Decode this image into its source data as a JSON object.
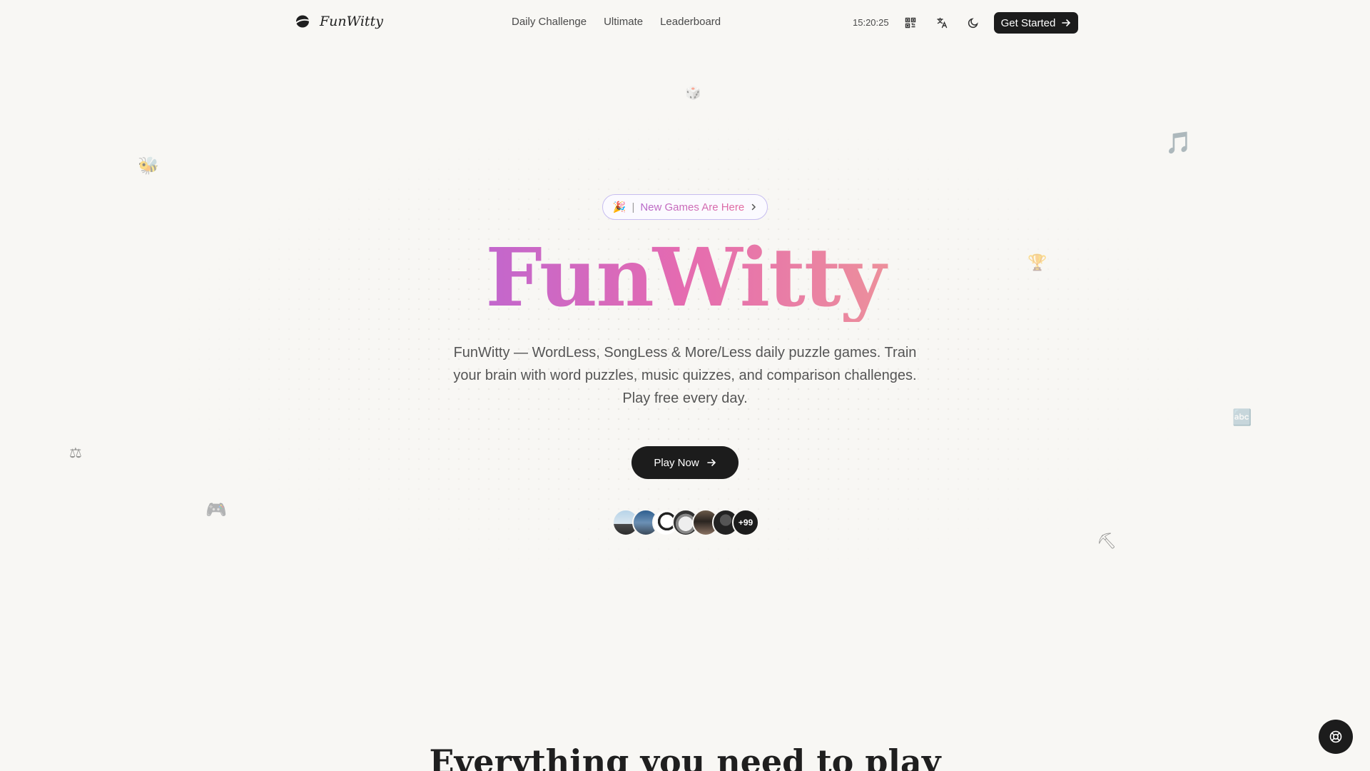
{
  "header": {
    "logo_text": "FunWitty",
    "nav": [
      "Daily Challenge",
      "Ultimate",
      "Leaderboard"
    ],
    "clock": "15:20:25",
    "icons": [
      "qr-code-icon",
      "translate-icon",
      "moon-icon"
    ],
    "get_started_label": "Get Started"
  },
  "hero": {
    "badge_emoji": "🎉",
    "badge_separator": "|",
    "badge_text": "New Games Are Here",
    "title": "FunWitty",
    "subtitle": "FunWitty — WordLess, SongLess & More/Less daily puzzle games. Train your brain with word puzzles, music quizzes, and comparison challenges. Play free every day.",
    "play_label": "Play Now",
    "avatar_more": "+99"
  },
  "decor": {
    "dice": "🎲",
    "bee": "🐝",
    "music": "🎵",
    "trophy": "🏆",
    "abc": "🔤",
    "scale": "⚖",
    "gamepad": "🎮",
    "pickaxe": "⛏"
  },
  "section": {
    "title": "Everything you need to play"
  },
  "colors": {
    "background": "#f8f7f4",
    "button": "#1c1c1c",
    "gradient_start": "#b565d8",
    "gradient_mid": "#e56bb0",
    "gradient_end": "#f1a98d"
  }
}
